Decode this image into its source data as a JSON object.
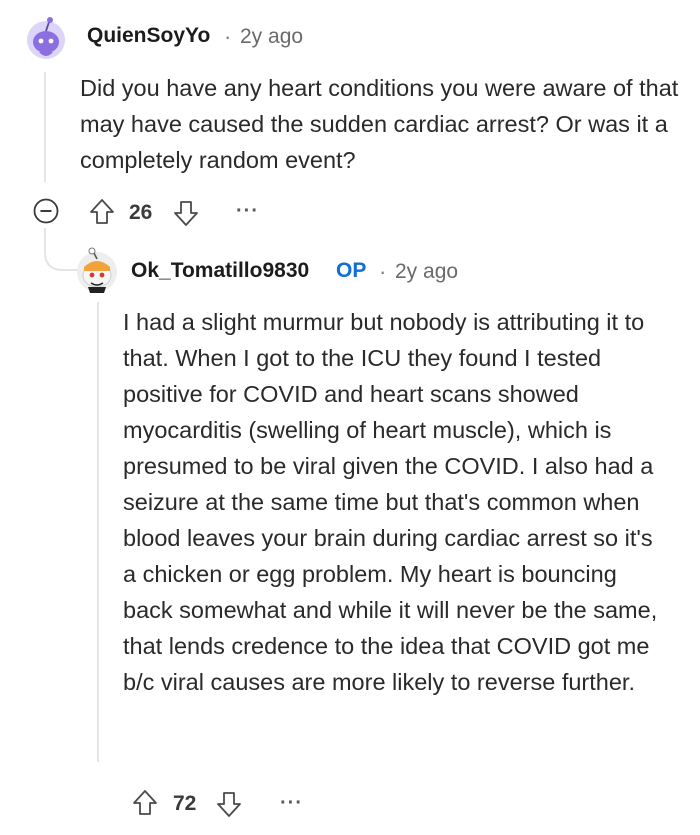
{
  "comments": [
    {
      "username": "QuienSoyYo",
      "separator": "·",
      "timestamp": "2y ago",
      "body": "Did you have any heart conditions you were aware of that may have caused the sudden cardiac arrest? Or was it a completely random event?",
      "votes": "26",
      "more": "···",
      "avatar_color": "#8b6fe0"
    },
    {
      "username": "Ok_Tomatillo9830",
      "op_label": "OP",
      "separator": "·",
      "timestamp": "2y ago",
      "body": "I had a slight murmur but nobody is attributing it to that. When I got to the ICU they found I tested positive for COVID and heart scans showed myocarditis (swelling of heart muscle), which is presumed to be viral given the COVID. I also had a seizure at the same time but that's common when blood leaves your brain during cardiac arrest so it's a chicken or egg problem. My heart is bouncing back somewhat and while it will never be the same, that lends credence to the idea that COVID got me b/c viral causes are more likely to reverse further.",
      "votes": "72",
      "more": "···",
      "op_color": "#0f6fd6"
    }
  ],
  "icons": {
    "collapse": "collapse-icon",
    "upvote": "upvote-icon",
    "downvote": "downvote-icon",
    "more": "more-options-icon",
    "avatar1": "snoo-avatar-icon",
    "avatar2": "snoo-avatar-icon"
  }
}
